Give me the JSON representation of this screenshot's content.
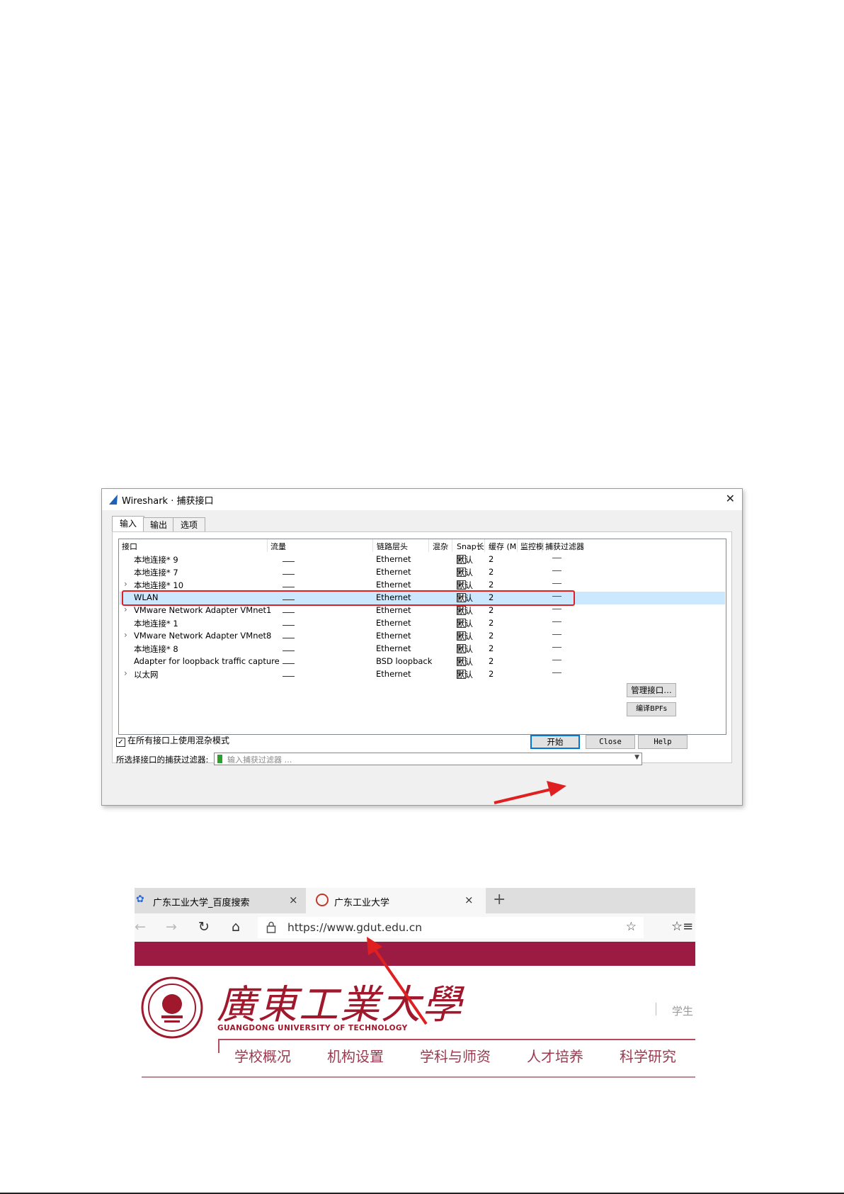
{
  "wireshark": {
    "title": "Wireshark · 捕获接口",
    "tabs": [
      "输入",
      "输出",
      "选项"
    ],
    "columns": [
      "接口",
      "流量",
      "链路层头",
      "混杂",
      "Snap长",
      "缓存 (M",
      "监控模",
      "捕获过滤器"
    ],
    "rows": [
      {
        "expand": "",
        "name": "本地连接* 9",
        "link": "Ethernet",
        "promisc": "☑",
        "snap": "默认",
        "buffer": "2"
      },
      {
        "expand": "",
        "name": "本地连接* 7",
        "link": "Ethernet",
        "promisc": "☑",
        "snap": "默认",
        "buffer": "2"
      },
      {
        "expand": "›",
        "name": "本地连接* 10",
        "link": "Ethernet",
        "promisc": "☑",
        "snap": "默认",
        "buffer": "2"
      },
      {
        "expand": "",
        "name": "WLAN",
        "link": "Ethernet",
        "promisc": "☑",
        "snap": "默认",
        "buffer": "2"
      },
      {
        "expand": "›",
        "name": "VMware Network Adapter VMnet1",
        "link": "Ethernet",
        "promisc": "☑",
        "snap": "默认",
        "buffer": "2"
      },
      {
        "expand": "",
        "name": "本地连接* 1",
        "link": "Ethernet",
        "promisc": "☑",
        "snap": "默认",
        "buffer": "2"
      },
      {
        "expand": "›",
        "name": "VMware Network Adapter VMnet8",
        "link": "Ethernet",
        "promisc": "☑",
        "snap": "默认",
        "buffer": "2"
      },
      {
        "expand": "",
        "name": "本地连接* 8",
        "link": "Ethernet",
        "promisc": "☑",
        "snap": "默认",
        "buffer": "2"
      },
      {
        "expand": "",
        "name": "Adapter for loopback traffic capture",
        "link": "BSD loopback",
        "promisc": "☑",
        "snap": "默认",
        "buffer": "2"
      },
      {
        "expand": "›",
        "name": "以太网",
        "link": "Ethernet",
        "promisc": "☑",
        "snap": "默认",
        "buffer": "2"
      }
    ],
    "selected_index": 3,
    "promisc_all_label": "在所有接口上使用混杂模式",
    "promisc_all_checked": true,
    "filter_label": "所选择接口的捕获过滤器:",
    "filter_placeholder": "输入捕获过滤器 …",
    "manage_button": "管理接口…",
    "compile_button": "编译BPFs",
    "start_button": "开始",
    "close_button": "Close",
    "help_button": "Help"
  },
  "browser": {
    "tabs": [
      {
        "title": "广东工业大学_百度搜索",
        "close": "×"
      },
      {
        "title": "广东工业大学",
        "close": "×"
      }
    ],
    "new_tab": "+",
    "nav": {
      "back": "←",
      "forward": "→",
      "refresh": "↻",
      "home": "⌂"
    },
    "url": "https://www.gdut.edu.cn",
    "favorite": "☆",
    "favorites_bar": "☆≡",
    "site": {
      "name_cn": "廣東工業大學",
      "name_en": "GUANGDONG UNIVERSITY OF TECHNOLOGY",
      "top_link": "学生",
      "menu": [
        "学校概况",
        "机构设置",
        "学科与师资",
        "人才培养",
        "科学研究"
      ]
    }
  },
  "colors": {
    "annotation_red": "#e02020",
    "maroon": "#9b1b42",
    "selection": "#cce8ff"
  }
}
